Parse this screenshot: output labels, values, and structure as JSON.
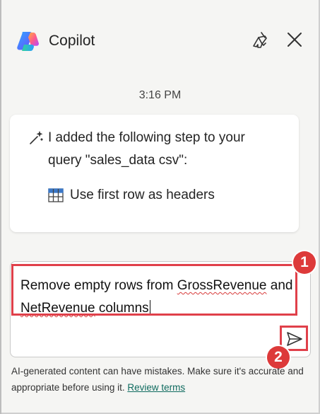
{
  "header": {
    "title": "Copilot",
    "clear_icon": "broom-icon",
    "close_icon": "close-icon"
  },
  "chat": {
    "timestamp": "3:16 PM",
    "message_line1": "I added the following step to your",
    "message_line2": "query \"sales_data csv\":",
    "step_label": "Use first row as headers"
  },
  "composer": {
    "text_part1": "Remove empty rows from ",
    "text_word_grossrevenue": "GrossRevenue",
    "text_part2": " and ",
    "text_word_netrevenue": "NetRevenue",
    "text_part3": " colum",
    "text_part4": "ns"
  },
  "annotations": {
    "badge1": "1",
    "badge2": "2"
  },
  "footer": {
    "disclaimer": "AI-generated content can have mistakes. Make sure it's accurate and appropriate before using it. ",
    "review_link": "Review terms"
  },
  "colors": {
    "highlight": "#e0404a",
    "badge": "#dd3a3a",
    "link": "#0f6b5f"
  }
}
